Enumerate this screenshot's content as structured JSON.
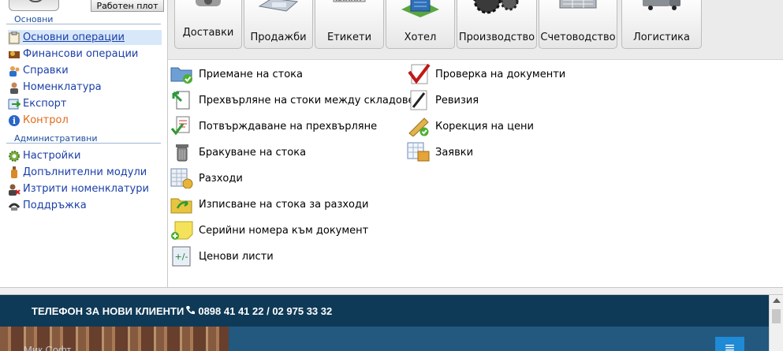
{
  "sidebar": {
    "work_button": "Работен плот",
    "section_main": "Основни",
    "section_admin": "Административни",
    "items_main": [
      {
        "label": "Основни операции",
        "icon": "clipboard-icon"
      },
      {
        "label": "Финансови операции",
        "icon": "coins-icon"
      },
      {
        "label": "Справки",
        "icon": "people-icon"
      },
      {
        "label": "Номенклатура",
        "icon": "person-icon"
      },
      {
        "label": "Експорт",
        "icon": "export-icon"
      },
      {
        "label": "Контрол",
        "icon": "info-icon"
      }
    ],
    "items_admin": [
      {
        "label": "Настройки",
        "icon": "gear-icon"
      },
      {
        "label": "Допълнителни модули",
        "icon": "bottle-icon"
      },
      {
        "label": "Изтрити номенклатури",
        "icon": "deleted-user-icon"
      },
      {
        "label": "Поддръжка",
        "icon": "phone-icon"
      }
    ]
  },
  "toolbar": {
    "modules": [
      {
        "label": "Доставки",
        "icon": "delivery-icon"
      },
      {
        "label": "Продажби",
        "icon": "cash-register-icon"
      },
      {
        "label": "Етикети",
        "icon": "barcode-icon"
      },
      {
        "label": "Хотел",
        "icon": "hotel-icon"
      },
      {
        "label": "Производство",
        "icon": "gears-icon"
      },
      {
        "label": "Счетоводство",
        "icon": "ledger-icon"
      },
      {
        "label": "Логистика",
        "icon": "truck-icon"
      }
    ]
  },
  "operations": {
    "left": [
      {
        "label": "Приемане на стока",
        "icon": "folder-check-icon"
      },
      {
        "label": "Прехвърляне на стоки между складове",
        "icon": "transfer-icon"
      },
      {
        "label": "Потвърждаване на прехвърляне",
        "icon": "checklist-icon"
      },
      {
        "label": "Бракуване на стока",
        "icon": "trash-can-icon"
      },
      {
        "label": "Разходи",
        "icon": "calculator-coins-icon"
      },
      {
        "label": "Изписване на стока за разходи",
        "icon": "folder-arrow-icon"
      },
      {
        "label": "Серийни номера към документ",
        "icon": "sticky-note-add-icon"
      },
      {
        "label": "Ценови листи",
        "icon": "price-list-icon"
      }
    ],
    "right": [
      {
        "label": "Проверка на документи",
        "icon": "document-check-icon"
      },
      {
        "label": "Ревизия",
        "icon": "pen-icon"
      },
      {
        "label": "Корекция на цени",
        "icon": "pencil-edit-icon"
      },
      {
        "label": "Заявки",
        "icon": "orders-grid-icon"
      }
    ]
  },
  "footer": {
    "phone_label": "ТЕЛЕФОН ЗА НОВИ КЛИЕНТИ",
    "phone_numbers": "0898 41 41 22 / 02 975 33 32",
    "logo_text": "Мик Софт",
    "menu_glyph": "≡"
  },
  "colors": {
    "link": "#1a3fa8",
    "control": "#e06a1a",
    "selected_bg": "#d8e8fa",
    "banner_bg": "#0f3a57",
    "menu_button": "#1f8ad6"
  }
}
